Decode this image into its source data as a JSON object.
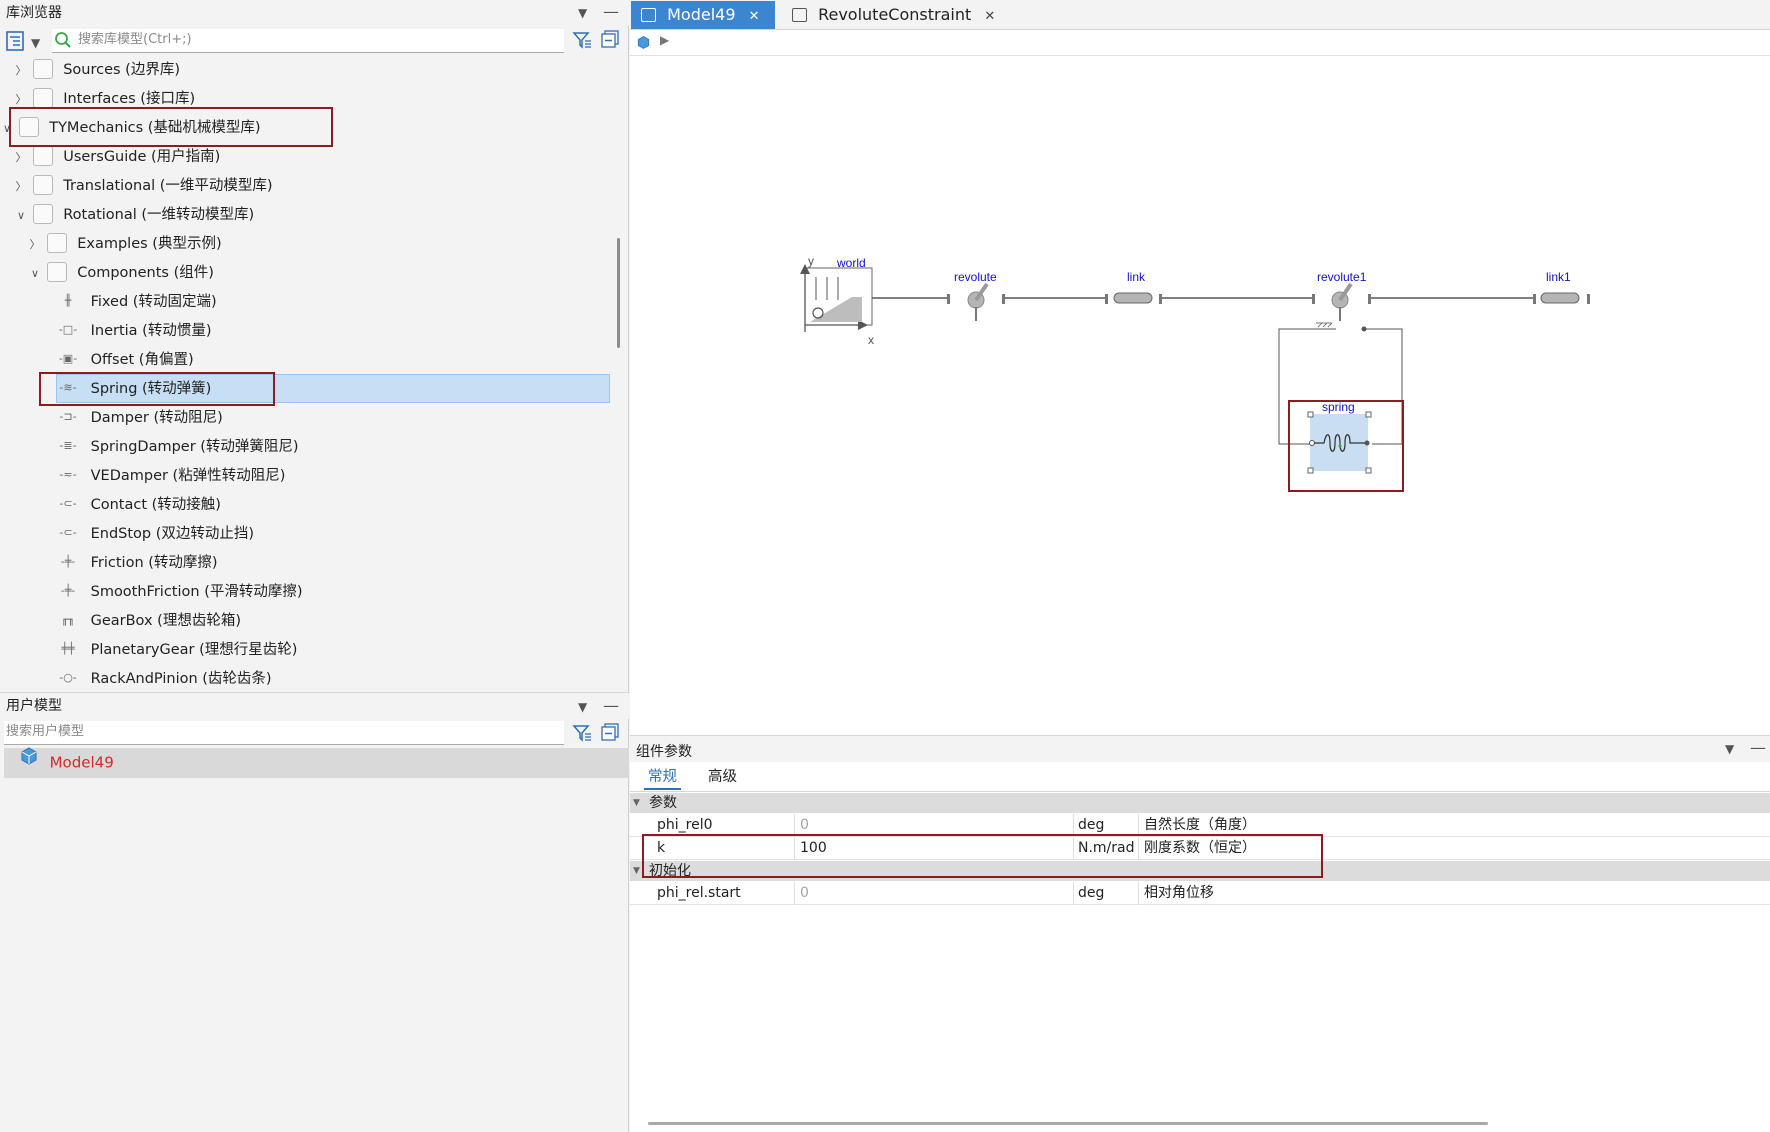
{
  "library_browser": {
    "title": "库浏览器",
    "search_placeholder": "搜索库模型(Ctrl+;)",
    "items": [
      {
        "label": "Sources (边界库)",
        "icon": "sources-icon"
      },
      {
        "label": "Interfaces (接口库)",
        "icon": "interfaces-icon"
      },
      {
        "label": "TYMechanics (基础机械模型库)",
        "icon": "library-icon"
      },
      {
        "label": "UsersGuide (用户指南)",
        "icon": "info-icon"
      },
      {
        "label": "Translational (一维平动模型库)",
        "icon": "translational-icon"
      },
      {
        "label": "Rotational (一维转动模型库)",
        "icon": "rotational-icon"
      },
      {
        "label": "Examples (典型示例)",
        "icon": "examples-icon"
      },
      {
        "label": "Components (组件)",
        "icon": "components-icon"
      },
      {
        "label": "Fixed (转动固定端)",
        "icon": "fixed-icon"
      },
      {
        "label": "Inertia (转动惯量)",
        "icon": "inertia-icon"
      },
      {
        "label": "Offset (角偏置)",
        "icon": "offset-icon"
      },
      {
        "label": "Spring (转动弹簧)",
        "icon": "spring-icon"
      },
      {
        "label": "Damper (转动阻尼)",
        "icon": "damper-icon"
      },
      {
        "label": "SpringDamper (转动弹簧阻尼)",
        "icon": "spring-damper-icon"
      },
      {
        "label": "VEDamper (粘弹性转动阻尼)",
        "icon": "vedamper-icon"
      },
      {
        "label": "Contact (转动接触)",
        "icon": "contact-icon"
      },
      {
        "label": "EndStop (双边转动止挡)",
        "icon": "endstop-icon"
      },
      {
        "label": "Friction (转动摩擦)",
        "icon": "friction-icon"
      },
      {
        "label": "SmoothFriction (平滑转动摩擦)",
        "icon": "smooth-friction-icon"
      },
      {
        "label": "GearBox (理想齿轮箱)",
        "icon": "gearbox-icon"
      },
      {
        "label": "PlanetaryGear (理想行星齿轮)",
        "icon": "planetary-gear-icon"
      },
      {
        "label": "RackAndPinion (齿轮齿条)",
        "icon": "rack-pinion-icon"
      }
    ]
  },
  "user_models": {
    "title": "用户模型",
    "search_placeholder": "搜索用户模型",
    "items": [
      {
        "label": "Model49",
        "icon": "model-cube-icon"
      }
    ]
  },
  "tabs": [
    {
      "label": "Model49",
      "active": true
    },
    {
      "label": "RevoluteConstraint",
      "active": false
    }
  ],
  "diagram": {
    "labels": {
      "world": "world",
      "revolute": "revolute",
      "link": "link",
      "revolute1": "revolute1",
      "link1": "link1",
      "spring": "spring",
      "axis_x": "x",
      "axis_y": "y"
    }
  },
  "component_params": {
    "title": "组件参数",
    "tabs": [
      "常规",
      "高级"
    ],
    "groups": [
      {
        "name": "参数",
        "rows": [
          {
            "name": "phi_rel0",
            "value": "0",
            "unit": "deg",
            "description": "自然长度（角度）",
            "default": true
          },
          {
            "name": "k",
            "value": "100",
            "unit": "N.m/rad",
            "description": "刚度系数（恒定）",
            "default": false
          }
        ]
      },
      {
        "name": "初始化",
        "rows": [
          {
            "name": "phi_rel.start",
            "value": "0",
            "unit": "deg",
            "description": "相对角位移",
            "default": true
          }
        ]
      }
    ]
  },
  "colors": {
    "accent": "#3c86d1",
    "highlight_box": "#8b1c22",
    "model_name": "#d42a2a",
    "diagram_label": "#1010d0"
  }
}
